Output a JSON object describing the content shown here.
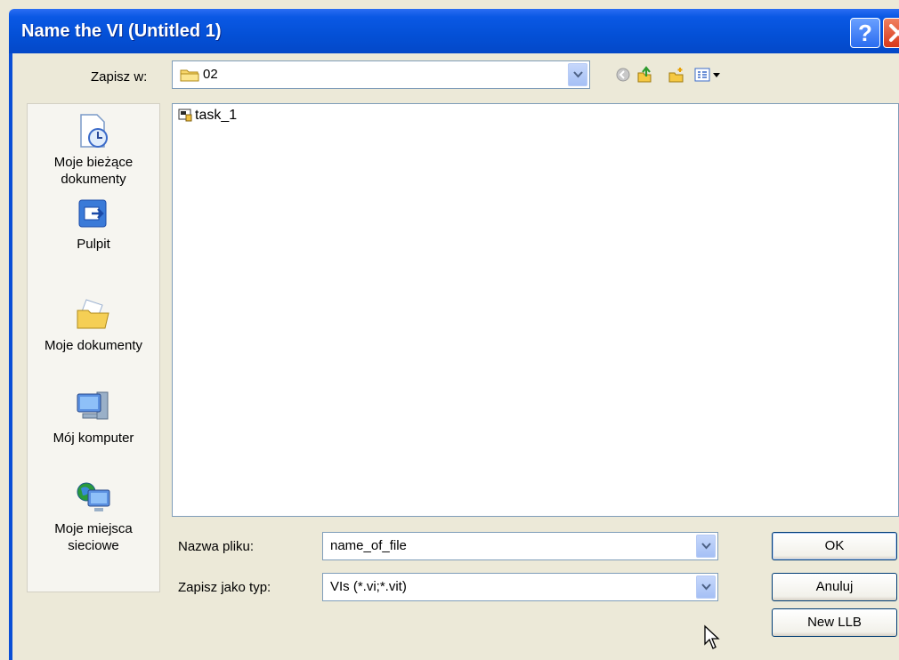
{
  "window": {
    "title": "Name the VI (Untitled 1)",
    "help_label": "?"
  },
  "savein": {
    "label": "Zapisz w:",
    "value": "02"
  },
  "places": [
    {
      "label_line1": "Moje bieżące",
      "label_line2": "dokumenty",
      "icon": "recent-documents-icon"
    },
    {
      "label_line1": "Pulpit",
      "label_line2": "",
      "icon": "desktop-icon"
    },
    {
      "label_line1": "Moje dokumenty",
      "label_line2": "",
      "icon": "my-documents-icon"
    },
    {
      "label_line1": "Mój komputer",
      "label_line2": "",
      "icon": "my-computer-icon"
    },
    {
      "label_line1": "Moje miejsca",
      "label_line2": "sieciowe",
      "icon": "network-places-icon"
    }
  ],
  "files": [
    {
      "name": "task_1",
      "icon": "vi-file-icon"
    }
  ],
  "filename": {
    "label": "Nazwa pliku:",
    "value": "name_of_file"
  },
  "filetype": {
    "label": "Zapisz jako typ:",
    "value": "VIs (*.vi;*.vit)"
  },
  "buttons": {
    "ok": "OK",
    "cancel": "Anuluj",
    "new_llb": "New LLB"
  },
  "colors": {
    "titlebar": "#0450d6",
    "dialog_bg": "#ece9d8",
    "border": "#7f9db9"
  }
}
